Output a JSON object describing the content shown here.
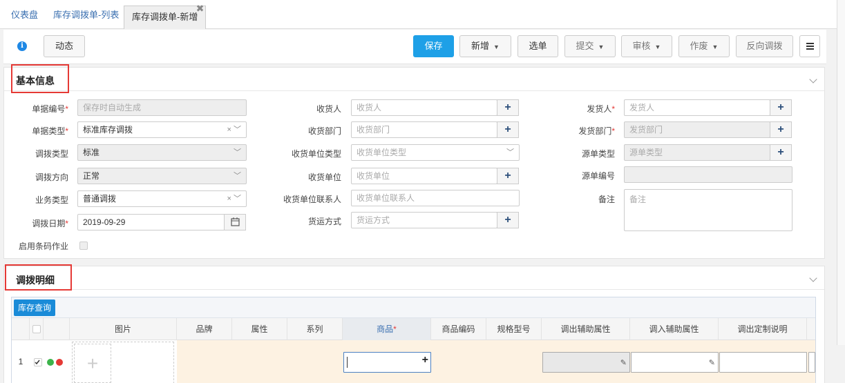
{
  "tabs": [
    {
      "label": "仪表盘"
    },
    {
      "label": "库存调拨单-列表"
    },
    {
      "label": "库存调拨单-新增"
    }
  ],
  "toolbar": {
    "info_icon": "info-circle-icon",
    "dynamic_label": "动态",
    "save_label": "保存",
    "new_label": "新增",
    "select_label": "选单",
    "submit_label": "提交",
    "audit_label": "审核",
    "void_label": "作废",
    "reverse_label": "反向调拨",
    "menu_icon": "hamburger-icon"
  },
  "basic": {
    "title": "基本信息",
    "doc_no_label": "单据编号",
    "doc_no_placeholder": "保存时自动生成",
    "doc_type_label": "单据类型",
    "doc_type_value": "标准库存调拨",
    "transfer_type_label": "调拨类型",
    "transfer_type_value": "标准",
    "direction_label": "调拨方向",
    "direction_value": "正常",
    "biz_type_label": "业务类型",
    "biz_type_value": "普通调拨",
    "date_label": "调拨日期",
    "date_value": "2019-09-29",
    "barcode_label": "启用条码作业",
    "receiver_label": "收货人",
    "receiver_placeholder": "收货人",
    "recv_dept_label": "收货部门",
    "recv_dept_placeholder": "收货部门",
    "recv_unit_type_label": "收货单位类型",
    "recv_unit_type_placeholder": "收货单位类型",
    "recv_unit_label": "收货单位",
    "recv_unit_placeholder": "收货单位",
    "recv_contact_label": "收货单位联系人",
    "recv_contact_placeholder": "收货单位联系人",
    "shipping_label": "货运方式",
    "shipping_placeholder": "货运方式",
    "shipper_label": "发货人",
    "shipper_placeholder": "发货人",
    "ship_dept_label": "发货部门",
    "ship_dept_placeholder": "发货部门",
    "src_type_label": "源单类型",
    "src_type_placeholder": "源单类型",
    "src_no_label": "源单编号",
    "remark_label": "备注",
    "remark_placeholder": "备注",
    "required_mark": "*",
    "clear_mark": "×",
    "plus_mark": "+"
  },
  "detail": {
    "title": "调拨明细",
    "stock_query_label": "库存查询",
    "columns": [
      "图片",
      "品牌",
      "属性",
      "系列",
      "商品",
      "商品编码",
      "规格型号",
      "调出辅助属性",
      "调入辅助属性",
      "调出定制说明"
    ],
    "row_number": "1"
  }
}
